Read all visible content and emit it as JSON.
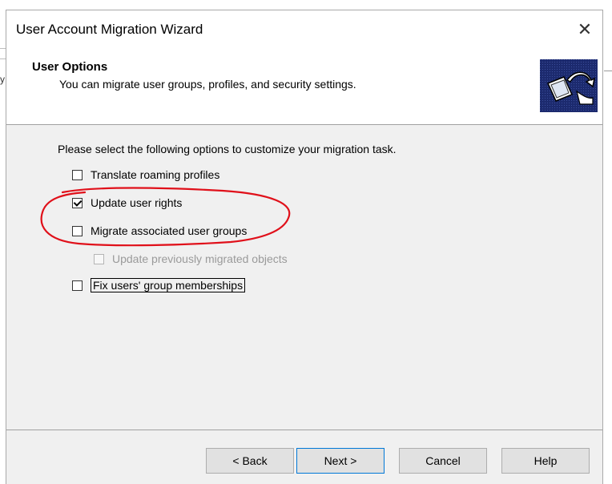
{
  "window": {
    "title": "User Account Migration Wizard",
    "close_glyph": "✕"
  },
  "header": {
    "title": "User Options",
    "subtitle": "You can migrate user groups, profiles, and security settings.",
    "icon": "migration-wizard-icon"
  },
  "content": {
    "intro": "Please select the following options to customize your migration task.",
    "options": [
      {
        "label": "Translate roaming profiles",
        "checked": false,
        "enabled": true
      },
      {
        "label": "Update user rights",
        "checked": true,
        "enabled": true
      },
      {
        "label": "Migrate associated user groups",
        "checked": false,
        "enabled": true
      },
      {
        "label": "Update previously migrated objects",
        "checked": false,
        "enabled": false
      },
      {
        "label": "Fix users' group memberships",
        "checked": false,
        "enabled": true,
        "focused": true
      }
    ]
  },
  "buttons": {
    "back": "< Back",
    "next": "Next >",
    "cancel": "Cancel",
    "help": "Help"
  },
  "colors": {
    "annotation": "#e0101a",
    "default_button_border": "#0078d7",
    "icon_blue": "#1c2a6e"
  }
}
